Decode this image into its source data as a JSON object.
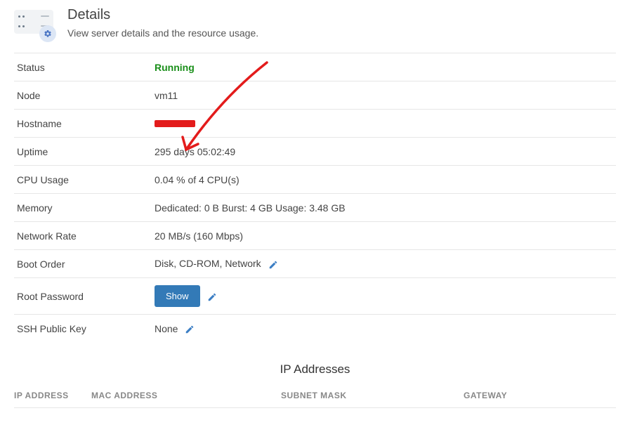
{
  "header": {
    "title": "Details",
    "subtitle": "View server details and the resource usage."
  },
  "details": {
    "status_label": "Status",
    "status_value": "Running",
    "node_label": "Node",
    "node_value": "vm11",
    "hostname_label": "Hostname",
    "uptime_label": "Uptime",
    "uptime_value": "295 days 05:02:49",
    "cpu_label": "CPU Usage",
    "cpu_value": "0.04 % of 4 CPU(s)",
    "memory_label": "Memory",
    "memory_value": "Dedicated: 0 B Burst: 4 GB Usage: 3.48 GB",
    "network_label": "Network Rate",
    "network_value": "20 MB/s (160 Mbps)",
    "boot_label": "Boot Order",
    "boot_value": "Disk, CD-ROM, Network",
    "root_label": "Root Password",
    "show_button": "Show",
    "ssh_label": "SSH Public Key",
    "ssh_value": "None"
  },
  "ip_section": {
    "title": "IP Addresses",
    "col_ip": "IP ADDRESS",
    "col_mac": "MAC ADDRESS",
    "col_subnet": "SUBNET MASK",
    "col_gateway": "GATEWAY"
  }
}
